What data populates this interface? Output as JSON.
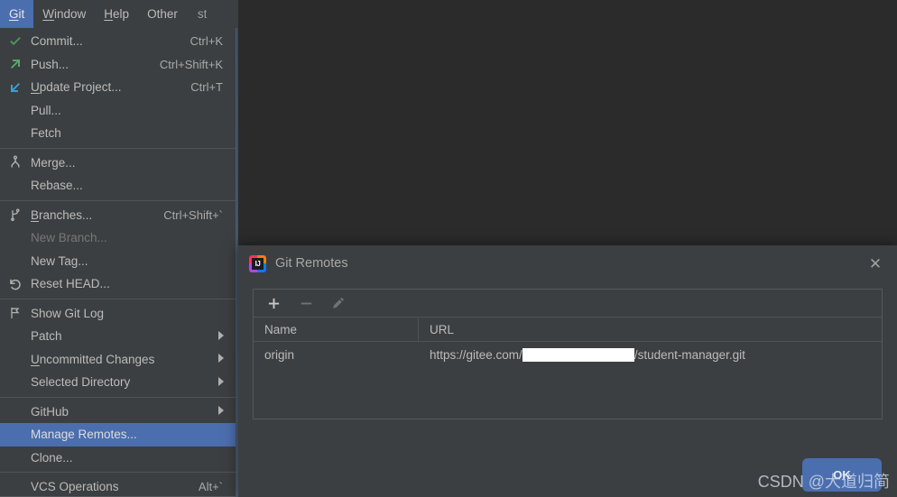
{
  "menubar": {
    "items": [
      {
        "label": "Git",
        "mnemonic": "G",
        "active": true
      },
      {
        "label": "Window",
        "mnemonic": "W",
        "active": false
      },
      {
        "label": "Help",
        "mnemonic": "H",
        "active": false
      },
      {
        "label": "Other",
        "mnemonic": "",
        "active": false
      }
    ],
    "overflow_text": "st"
  },
  "git_menu": {
    "items": [
      {
        "label": "Commit...",
        "accel": "Ctrl+K",
        "icon": "commit-check-icon",
        "state": "normal",
        "submenu": false,
        "mnemonic": ""
      },
      {
        "label": "Push...",
        "accel": "Ctrl+Shift+K",
        "icon": "push-arrow-icon",
        "state": "normal",
        "submenu": false,
        "mnemonic": ""
      },
      {
        "label": "Update Project...",
        "accel": "Ctrl+T",
        "icon": "update-arrow-icon",
        "state": "normal",
        "submenu": false,
        "mnemonic": "U"
      },
      {
        "label": "Pull...",
        "accel": "",
        "icon": "",
        "state": "normal",
        "submenu": false,
        "mnemonic": ""
      },
      {
        "label": "Fetch",
        "accel": "",
        "icon": "",
        "state": "normal",
        "submenu": false,
        "mnemonic": ""
      },
      {
        "separator": true
      },
      {
        "label": "Merge...",
        "accel": "",
        "icon": "merge-icon",
        "state": "normal",
        "submenu": false,
        "mnemonic": ""
      },
      {
        "label": "Rebase...",
        "accel": "",
        "icon": "",
        "state": "normal",
        "submenu": false,
        "mnemonic": ""
      },
      {
        "separator": true
      },
      {
        "label": "Branches...",
        "accel": "Ctrl+Shift+`",
        "icon": "branch-icon",
        "state": "normal",
        "submenu": false,
        "mnemonic": "B"
      },
      {
        "label": "New Branch...",
        "accel": "",
        "icon": "",
        "state": "disabled",
        "submenu": false,
        "mnemonic": ""
      },
      {
        "label": "New Tag...",
        "accel": "",
        "icon": "",
        "state": "normal",
        "submenu": false,
        "mnemonic": ""
      },
      {
        "label": "Reset HEAD...",
        "accel": "",
        "icon": "reset-undo-icon",
        "state": "normal",
        "submenu": false,
        "mnemonic": ""
      },
      {
        "separator": true
      },
      {
        "label": "Show Git Log",
        "accel": "",
        "icon": "git-log-flag-icon",
        "state": "normal",
        "submenu": false,
        "mnemonic": ""
      },
      {
        "label": "Patch",
        "accel": "",
        "icon": "",
        "state": "normal",
        "submenu": true,
        "mnemonic": ""
      },
      {
        "label": "Uncommitted Changes",
        "accel": "",
        "icon": "",
        "state": "normal",
        "submenu": true,
        "mnemonic": "U"
      },
      {
        "label": "Selected Directory",
        "accel": "",
        "icon": "",
        "state": "normal",
        "submenu": true,
        "mnemonic": ""
      },
      {
        "separator": true
      },
      {
        "label": "GitHub",
        "accel": "",
        "icon": "",
        "state": "normal",
        "submenu": true,
        "mnemonic": ""
      },
      {
        "label": "Manage Remotes...",
        "accel": "",
        "icon": "",
        "state": "selected",
        "submenu": false,
        "mnemonic": ""
      },
      {
        "label": "Clone...",
        "accel": "",
        "icon": "",
        "state": "normal",
        "submenu": false,
        "mnemonic": ""
      },
      {
        "separator": true
      },
      {
        "label": "VCS Operations",
        "accel": "Alt+`",
        "icon": "",
        "state": "normal",
        "submenu": false,
        "mnemonic": ""
      }
    ]
  },
  "dialog": {
    "title": "Git Remotes",
    "app_icon": "intellij-idea-icon",
    "logo_text": "IJ",
    "close_icon": "close-icon",
    "close_glyph": "✕",
    "toolbar": [
      {
        "name": "add-remote-button",
        "icon": "plus-icon",
        "glyph": "+",
        "enabled": true
      },
      {
        "name": "remove-remote-button",
        "icon": "minus-icon",
        "glyph": "−",
        "enabled": false
      },
      {
        "name": "edit-remote-button",
        "icon": "pencil-icon",
        "glyph": "✎",
        "enabled": false
      }
    ],
    "table": {
      "columns": [
        "Name",
        "URL"
      ],
      "rows": [
        {
          "name": "origin",
          "url_prefix": "https://gitee.com/",
          "url_redacted": true,
          "url_suffix": "/student-manager.git"
        }
      ]
    },
    "ok_label": "OK"
  },
  "watermark": {
    "text": "CSDN @大道归简"
  },
  "colors": {
    "menu_bg": "#3c3f41",
    "editor_bg": "#2b2b2b",
    "accent_blue": "#4b6eaf",
    "text": "#bbbbbb",
    "text_disabled": "#777777",
    "commit_green": "#499c54",
    "push_green": "#59a869",
    "update_blue": "#389fd6",
    "border": "#555759"
  }
}
